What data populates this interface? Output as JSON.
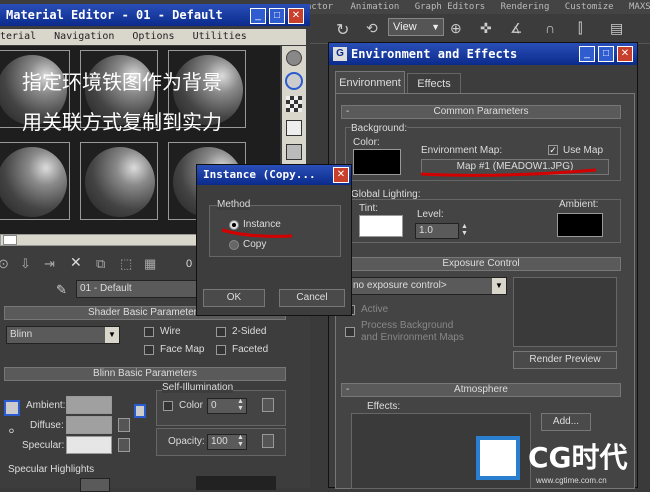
{
  "main_menu": [
    "actor",
    "Animation",
    "Graph Editors",
    "Rendering",
    "Customize",
    "MAXScri"
  ],
  "viewport_select": "View",
  "mat_editor": {
    "title": "Material Editor - 01 - Default",
    "menu": [
      "terial",
      "Navigation",
      "Options",
      "Utilities"
    ],
    "overlay_line1": "指定环境铁图作为背景",
    "overlay_line2": "用关联方式复制到实力",
    "slot_name": "01 - Default",
    "zero_label": "0",
    "shader": {
      "rollout": "Shader Basic Parameters",
      "type": "Blinn",
      "wire": "Wire",
      "two_sided": "2-Sided",
      "face_map": "Face Map",
      "faceted": "Faceted"
    },
    "blinn": {
      "rollout": "Blinn Basic Parameters",
      "self_illum": "Self-Illumination",
      "color_label": "Color",
      "color_value": "0",
      "ambient": "Ambient:",
      "diffuse": "Diffuse:",
      "specular": "Specular:",
      "opacity_label": "Opacity:",
      "opacity_value": "100"
    },
    "spec_highlights": "Specular Highlights"
  },
  "env": {
    "title": "Environment and Effects",
    "tabs": [
      "Environment",
      "Effects"
    ],
    "common_rollout": "Common Parameters",
    "background": "Background:",
    "color": "Color:",
    "env_map": "Environment Map:",
    "use_map": "Use Map",
    "map_button": "Map #1 (MEADOW1.JPG)",
    "global_lighting": "Global Lighting:",
    "tint": "Tint:",
    "level": "Level:",
    "level_value": "1.0",
    "ambient": "Ambient:",
    "exposure_rollout": "Exposure Control",
    "exposure_value": "no exposure control>",
    "active": "Active",
    "process_bg_1": "Process Background",
    "process_bg_2": "and Environment Maps",
    "render_preview": "Render Preview",
    "atmosphere_rollout": "Atmosphere",
    "effects": "Effects:",
    "add": "Add..."
  },
  "instance_dlg": {
    "title": "Instance (Copy...",
    "method": "Method",
    "instance": "Instance",
    "copy": "Copy",
    "ok": "OK",
    "cancel": "Cancel"
  },
  "watermark": {
    "brand": "CG时代",
    "url": "www.cgtime.com.cn"
  },
  "colors": {
    "annotation": "#d40000",
    "titlebar": "#0b2b8c"
  }
}
